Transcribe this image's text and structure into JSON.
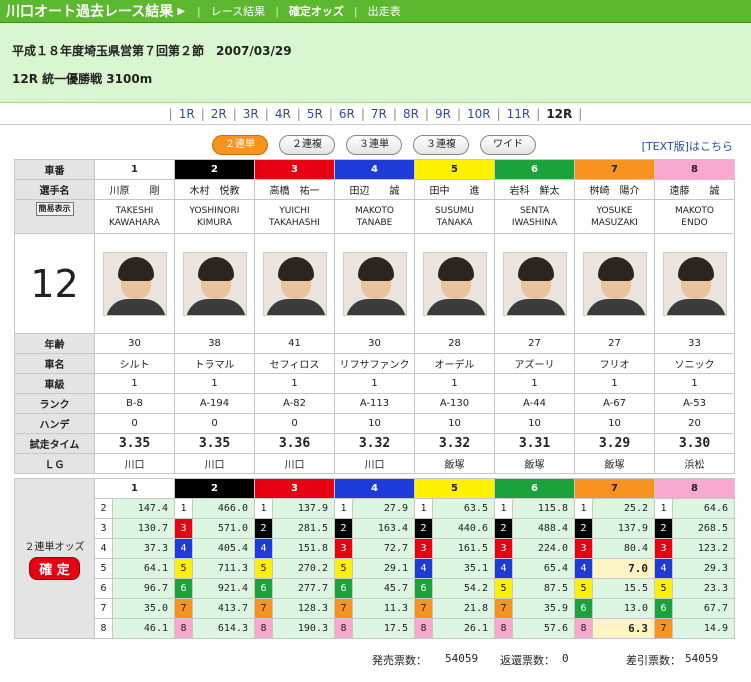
{
  "header": {
    "title": "川口オート過去レース結果",
    "links": [
      "レース結果",
      "確定オッズ",
      "出走表"
    ]
  },
  "race_info": {
    "line1": "平成１８年度埼玉県営第７回第２節　2007/03/29",
    "line2": "12R 統一優勝戦 3100m"
  },
  "race_nav": [
    "1R",
    "2R",
    "3R",
    "4R",
    "5R",
    "6R",
    "7R",
    "8R",
    "9R",
    "10R",
    "11R",
    "12R"
  ],
  "odds_tabs": [
    "２連単",
    "２連複",
    "３連単",
    "３連複",
    "ワイド"
  ],
  "text_version_link": "[TEXT版]はこちら",
  "row_labels": {
    "car_no": "車番",
    "name": "選手名",
    "display_select": "簡易表示",
    "age": "年齢",
    "car_name": "車名",
    "class": "車級",
    "rank": "ランク",
    "handicap": "ハンデ",
    "trial_time": "試走タイム",
    "lg": "ＬＧ"
  },
  "race_number": "12",
  "racers": [
    {
      "no": "1",
      "name": "川原　　剛",
      "en1": "TAKESHI",
      "en2": "KAWAHARA",
      "age": "30",
      "car": "シルト",
      "class": "1",
      "rank": "B-8",
      "handicap": "0",
      "trial": "3.35",
      "lg": "川口"
    },
    {
      "no": "2",
      "name": "木村　悦教",
      "en1": "YOSHINORI",
      "en2": "KIMURA",
      "age": "38",
      "car": "トラマル",
      "class": "1",
      "rank": "A-194",
      "handicap": "0",
      "trial": "3.35",
      "lg": "川口"
    },
    {
      "no": "3",
      "name": "高橋　祐一",
      "en1": "YUICHI",
      "en2": "TAKAHASHI",
      "age": "41",
      "car": "セフィロス",
      "class": "1",
      "rank": "A-82",
      "handicap": "0",
      "trial": "3.36",
      "lg": "川口"
    },
    {
      "no": "4",
      "name": "田辺　　誠",
      "en1": "MAKOTO",
      "en2": "TANABE",
      "age": "30",
      "car": "リフサファンク",
      "class": "1",
      "rank": "A-113",
      "handicap": "10",
      "trial": "3.32",
      "lg": "川口"
    },
    {
      "no": "5",
      "name": "田中　　進",
      "en1": "SUSUMU",
      "en2": "TANAKA",
      "age": "28",
      "car": "オーデル",
      "class": "1",
      "rank": "A-130",
      "handicap": "10",
      "trial": "3.32",
      "lg": "飯塚"
    },
    {
      "no": "6",
      "name": "岩科　鮮太",
      "en1": "SENTA",
      "en2": "IWASHINA",
      "age": "27",
      "car": "アズーリ",
      "class": "1",
      "rank": "A-44",
      "handicap": "10",
      "trial": "3.31",
      "lg": "飯塚"
    },
    {
      "no": "7",
      "name": "桝崎　陽介",
      "en1": "YOSUKE",
      "en2": "MASUZAKI",
      "age": "27",
      "car": "フリオ",
      "class": "1",
      "rank": "A-67",
      "handicap": "10",
      "trial": "3.29",
      "lg": "飯塚"
    },
    {
      "no": "8",
      "name": "遠藤　　誠",
      "en1": "MAKOTO",
      "en2": "ENDO",
      "age": "33",
      "car": "ソニック",
      "class": "1",
      "rank": "A-53",
      "handicap": "20",
      "trial": "3.30",
      "lg": "浜松"
    }
  ],
  "odds": {
    "label": "２連単オッズ",
    "status": "確 定",
    "headers": [
      "1",
      "2",
      "3",
      "4",
      "5",
      "6",
      "7",
      "8"
    ],
    "columns": [
      [
        [
          "2",
          "147.4"
        ],
        [
          "3",
          "130.7"
        ],
        [
          "4",
          "37.3"
        ],
        [
          "5",
          "64.1"
        ],
        [
          "6",
          "96.7"
        ],
        [
          "7",
          "35.0"
        ],
        [
          "8",
          "46.1"
        ]
      ],
      [
        [
          "1",
          "466.0"
        ],
        [
          "3",
          "571.0"
        ],
        [
          "4",
          "405.4"
        ],
        [
          "5",
          "711.3"
        ],
        [
          "6",
          "921.4"
        ],
        [
          "7",
          "413.7"
        ],
        [
          "8",
          "614.3"
        ]
      ],
      [
        [
          "1",
          "137.9"
        ],
        [
          "2",
          "281.5"
        ],
        [
          "4",
          "151.8"
        ],
        [
          "5",
          "270.2"
        ],
        [
          "6",
          "277.7"
        ],
        [
          "7",
          "128.3"
        ],
        [
          "8",
          "190.3"
        ]
      ],
      [
        [
          "1",
          "27.9"
        ],
        [
          "2",
          "163.4"
        ],
        [
          "3",
          "72.7"
        ],
        [
          "5",
          "29.1"
        ],
        [
          "6",
          "45.7"
        ],
        [
          "7",
          "11.3"
        ],
        [
          "8",
          "17.5"
        ]
      ],
      [
        [
          "1",
          "63.5"
        ],
        [
          "2",
          "440.6"
        ],
        [
          "3",
          "161.5"
        ],
        [
          "4",
          "35.1"
        ],
        [
          "6",
          "54.2"
        ],
        [
          "7",
          "21.8"
        ],
        [
          "8",
          "26.1"
        ]
      ],
      [
        [
          "1",
          "115.8"
        ],
        [
          "2",
          "488.4"
        ],
        [
          "3",
          "224.0"
        ],
        [
          "4",
          "65.4"
        ],
        [
          "5",
          "87.5"
        ],
        [
          "7",
          "35.9"
        ],
        [
          "8",
          "57.6"
        ]
      ],
      [
        [
          "1",
          "25.2"
        ],
        [
          "2",
          "137.9"
        ],
        [
          "3",
          "80.4"
        ],
        [
          "4",
          "7.0"
        ],
        [
          "5",
          "15.5"
        ],
        [
          "6",
          "13.0"
        ],
        [
          "8",
          "6.3"
        ]
      ],
      [
        [
          "1",
          "64.6"
        ],
        [
          "2",
          "268.5"
        ],
        [
          "3",
          "123.2"
        ],
        [
          "4",
          "29.3"
        ],
        [
          "5",
          "23.3"
        ],
        [
          "6",
          "67.7"
        ],
        [
          "7",
          "14.9"
        ]
      ]
    ]
  },
  "totals": {
    "sold_label": "発売票数：",
    "sold": "54059",
    "refund_label": "返還票数：",
    "refund": "0",
    "net_label": "差引票数：",
    "net": "54059"
  }
}
